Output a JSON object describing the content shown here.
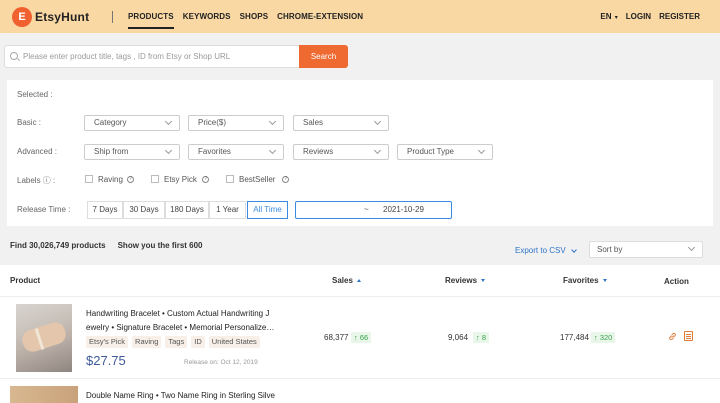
{
  "header": {
    "logo_letter": "E",
    "logo_text": "EtsyHunt",
    "nav": [
      "PRODUCTS",
      "KEYWORDS",
      "SHOPS",
      "CHROME-EXTENSION"
    ],
    "language": "EN",
    "login": "LOGIN",
    "register": "REGISTER"
  },
  "search": {
    "placeholder": "Please enter product title, tags , ID from Etsy or Shop URL",
    "button": "Search"
  },
  "filters": {
    "selected_label": "Selected :",
    "basic_label": "Basic :",
    "basic": [
      "Category",
      "Price($)",
      "Sales"
    ],
    "advanced_label": "Advanced :",
    "advanced": [
      "Ship from",
      "Favorites",
      "Reviews",
      "Product Type"
    ],
    "labels_label": "Labels ⓘ :",
    "labels": [
      "Raving",
      "Etsy Pick",
      "BestSeller"
    ],
    "release_label": "Release Time :",
    "release_options": [
      "7 Days",
      "30 Days",
      "180 Days",
      "1 Year",
      "All Time"
    ],
    "date_separator": "~",
    "date_end": "2021-10-29"
  },
  "results": {
    "found": "Find 30,026,749 products",
    "showing": "Show you the first 600",
    "export": "Export to CSV",
    "sort_by": "Sort by"
  },
  "table": {
    "headers": {
      "product": "Product",
      "sales": "Sales",
      "reviews": "Reviews",
      "favorites": "Favorites",
      "action": "Action"
    },
    "rows": [
      {
        "title_line1": "Handwriting Bracelet • Custom Actual Handwriting J",
        "title_line2": "ewelry • Signature Bracelet • Memorial Personalize…",
        "tags": [
          "Etsy's Pick",
          "Raving",
          "Tags",
          "ID",
          "United States"
        ],
        "price": "$27.75",
        "release": "Release on: Oct 12, 2019",
        "sales": "68,377",
        "sales_delta": "↑ 66",
        "reviews": "9,064",
        "reviews_delta": "↑ 8",
        "favorites": "177,484",
        "favorites_delta": "↑ 320"
      },
      {
        "title_line1": "Double Name Ring • Two Name Ring in Sterling Silve"
      }
    ]
  },
  "colors": {
    "header_bg": "#f9d8a4",
    "accent_orange": "#ee6a31",
    "link_blue": "#2f74c8",
    "up_green": "#3aa34a"
  }
}
